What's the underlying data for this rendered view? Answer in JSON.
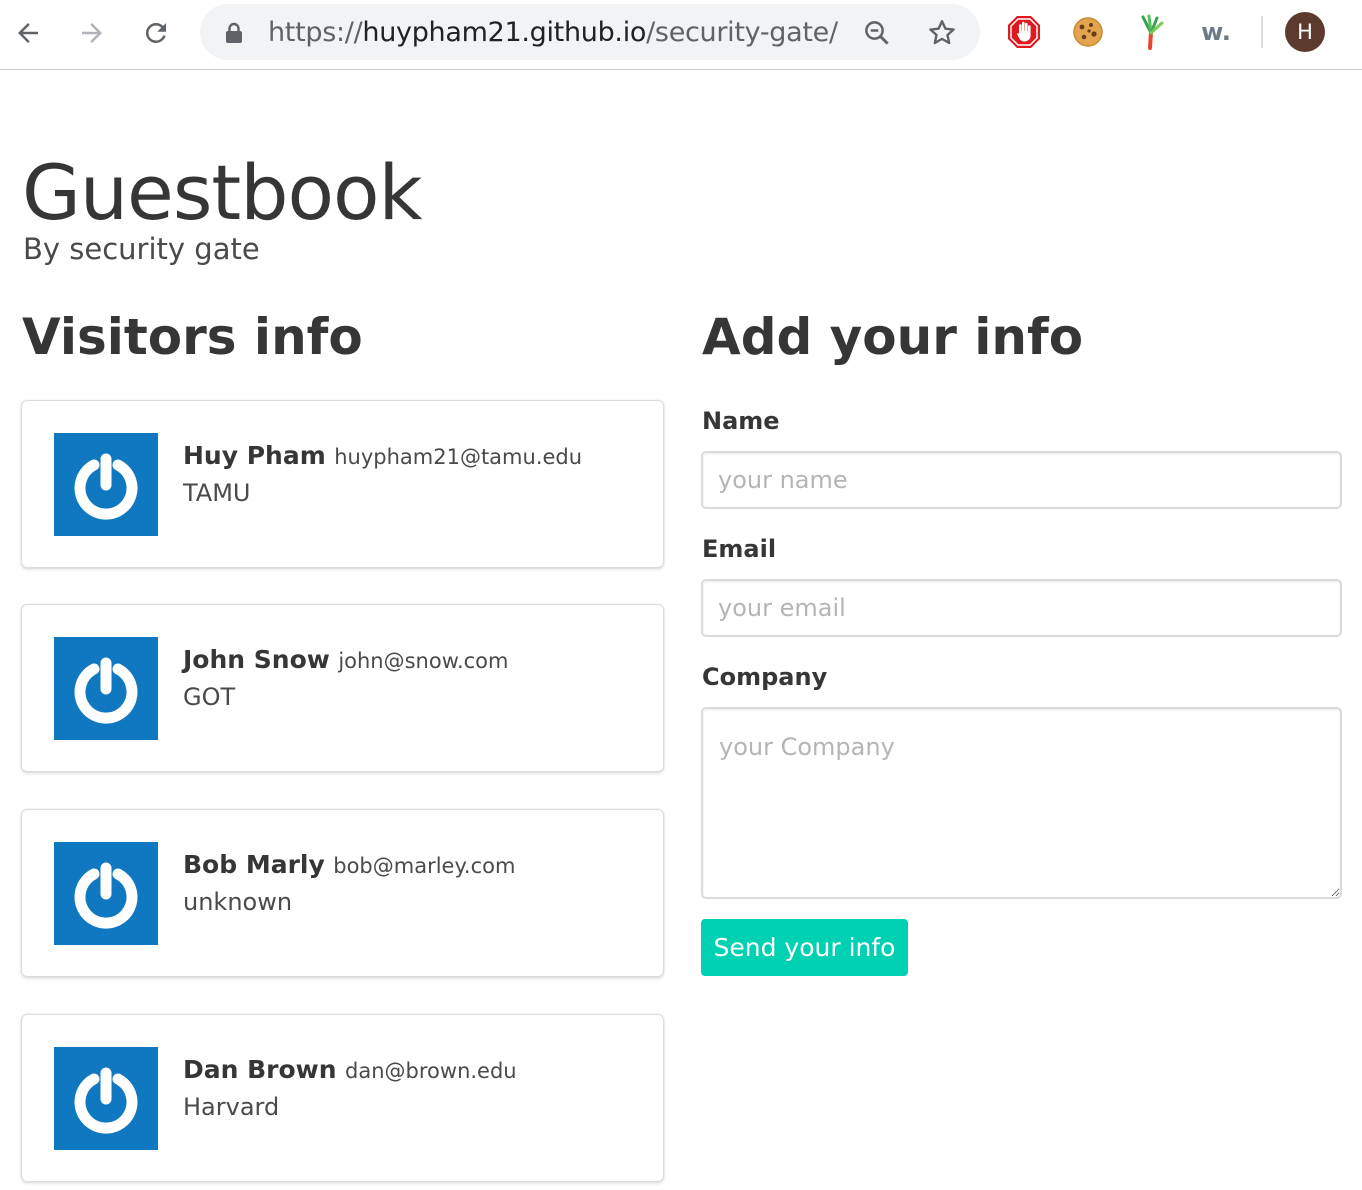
{
  "browser": {
    "url_scheme": "https://",
    "url_host": "huypham21.github.io",
    "url_path": "/security-gate/",
    "profile_initial": "H",
    "extension_w_label": "w.",
    "icons": [
      "back-arrow-icon",
      "forward-arrow-icon",
      "reload-icon",
      "lock-icon",
      "zoom-icon",
      "bookmark-star-icon",
      "stop-hand-icon",
      "cookie-icon",
      "leek-icon",
      "w-icon"
    ]
  },
  "page": {
    "title": "Guestbook",
    "subtitle": "By security gate"
  },
  "visitors": {
    "heading": "Visitors info",
    "items": [
      {
        "name": "Huy Pham",
        "email": "huypham21@tamu.edu",
        "company": "TAMU"
      },
      {
        "name": "John Snow",
        "email": "john@snow.com",
        "company": "GOT"
      },
      {
        "name": "Bob Marly",
        "email": "bob@marley.com",
        "company": "unknown"
      },
      {
        "name": "Dan Brown",
        "email": "dan@brown.edu",
        "company": "Harvard"
      }
    ]
  },
  "form": {
    "heading": "Add your info",
    "name_label": "Name",
    "name_placeholder": "your name",
    "email_label": "Email",
    "email_placeholder": "your email",
    "company_label": "Company",
    "company_placeholder": "your Company",
    "submit_label": "Send your info"
  },
  "colors": {
    "accent": "#00d1b2",
    "avatar_tile": "#0f78c1",
    "heading_text": "#363636"
  }
}
